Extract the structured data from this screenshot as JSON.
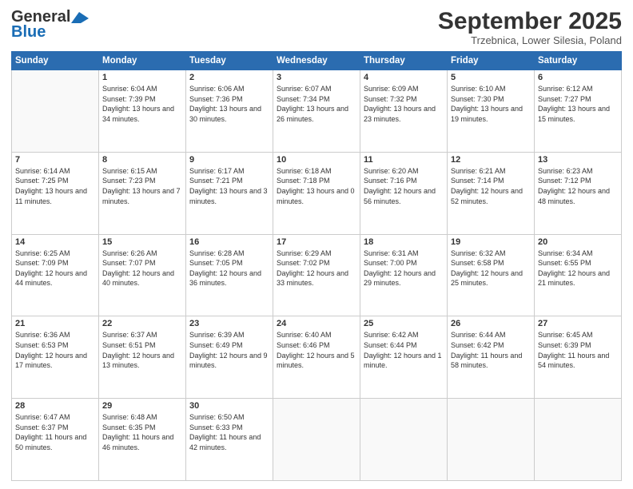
{
  "logo": {
    "line1": "General",
    "line2": "Blue",
    "tagline": ""
  },
  "header": {
    "month_year": "September 2025",
    "location": "Trzebnica, Lower Silesia, Poland"
  },
  "weekdays": [
    "Sunday",
    "Monday",
    "Tuesday",
    "Wednesday",
    "Thursday",
    "Friday",
    "Saturday"
  ],
  "weeks": [
    [
      {
        "day": null
      },
      {
        "day": "1",
        "sunrise": "6:04 AM",
        "sunset": "7:39 PM",
        "daylight": "13 hours and 34 minutes."
      },
      {
        "day": "2",
        "sunrise": "6:06 AM",
        "sunset": "7:36 PM",
        "daylight": "13 hours and 30 minutes."
      },
      {
        "day": "3",
        "sunrise": "6:07 AM",
        "sunset": "7:34 PM",
        "daylight": "13 hours and 26 minutes."
      },
      {
        "day": "4",
        "sunrise": "6:09 AM",
        "sunset": "7:32 PM",
        "daylight": "13 hours and 23 minutes."
      },
      {
        "day": "5",
        "sunrise": "6:10 AM",
        "sunset": "7:30 PM",
        "daylight": "13 hours and 19 minutes."
      },
      {
        "day": "6",
        "sunrise": "6:12 AM",
        "sunset": "7:27 PM",
        "daylight": "13 hours and 15 minutes."
      }
    ],
    [
      {
        "day": "7",
        "sunrise": "6:14 AM",
        "sunset": "7:25 PM",
        "daylight": "13 hours and 11 minutes."
      },
      {
        "day": "8",
        "sunrise": "6:15 AM",
        "sunset": "7:23 PM",
        "daylight": "13 hours and 7 minutes."
      },
      {
        "day": "9",
        "sunrise": "6:17 AM",
        "sunset": "7:21 PM",
        "daylight": "13 hours and 3 minutes."
      },
      {
        "day": "10",
        "sunrise": "6:18 AM",
        "sunset": "7:18 PM",
        "daylight": "13 hours and 0 minutes."
      },
      {
        "day": "11",
        "sunrise": "6:20 AM",
        "sunset": "7:16 PM",
        "daylight": "12 hours and 56 minutes."
      },
      {
        "day": "12",
        "sunrise": "6:21 AM",
        "sunset": "7:14 PM",
        "daylight": "12 hours and 52 minutes."
      },
      {
        "day": "13",
        "sunrise": "6:23 AM",
        "sunset": "7:12 PM",
        "daylight": "12 hours and 48 minutes."
      }
    ],
    [
      {
        "day": "14",
        "sunrise": "6:25 AM",
        "sunset": "7:09 PM",
        "daylight": "12 hours and 44 minutes."
      },
      {
        "day": "15",
        "sunrise": "6:26 AM",
        "sunset": "7:07 PM",
        "daylight": "12 hours and 40 minutes."
      },
      {
        "day": "16",
        "sunrise": "6:28 AM",
        "sunset": "7:05 PM",
        "daylight": "12 hours and 36 minutes."
      },
      {
        "day": "17",
        "sunrise": "6:29 AM",
        "sunset": "7:02 PM",
        "daylight": "12 hours and 33 minutes."
      },
      {
        "day": "18",
        "sunrise": "6:31 AM",
        "sunset": "7:00 PM",
        "daylight": "12 hours and 29 minutes."
      },
      {
        "day": "19",
        "sunrise": "6:32 AM",
        "sunset": "6:58 PM",
        "daylight": "12 hours and 25 minutes."
      },
      {
        "day": "20",
        "sunrise": "6:34 AM",
        "sunset": "6:55 PM",
        "daylight": "12 hours and 21 minutes."
      }
    ],
    [
      {
        "day": "21",
        "sunrise": "6:36 AM",
        "sunset": "6:53 PM",
        "daylight": "12 hours and 17 minutes."
      },
      {
        "day": "22",
        "sunrise": "6:37 AM",
        "sunset": "6:51 PM",
        "daylight": "12 hours and 13 minutes."
      },
      {
        "day": "23",
        "sunrise": "6:39 AM",
        "sunset": "6:49 PM",
        "daylight": "12 hours and 9 minutes."
      },
      {
        "day": "24",
        "sunrise": "6:40 AM",
        "sunset": "6:46 PM",
        "daylight": "12 hours and 5 minutes."
      },
      {
        "day": "25",
        "sunrise": "6:42 AM",
        "sunset": "6:44 PM",
        "daylight": "12 hours and 1 minute."
      },
      {
        "day": "26",
        "sunrise": "6:44 AM",
        "sunset": "6:42 PM",
        "daylight": "11 hours and 58 minutes."
      },
      {
        "day": "27",
        "sunrise": "6:45 AM",
        "sunset": "6:39 PM",
        "daylight": "11 hours and 54 minutes."
      }
    ],
    [
      {
        "day": "28",
        "sunrise": "6:47 AM",
        "sunset": "6:37 PM",
        "daylight": "11 hours and 50 minutes."
      },
      {
        "day": "29",
        "sunrise": "6:48 AM",
        "sunset": "6:35 PM",
        "daylight": "11 hours and 46 minutes."
      },
      {
        "day": "30",
        "sunrise": "6:50 AM",
        "sunset": "6:33 PM",
        "daylight": "11 hours and 42 minutes."
      },
      {
        "day": null
      },
      {
        "day": null
      },
      {
        "day": null
      },
      {
        "day": null
      }
    ]
  ]
}
